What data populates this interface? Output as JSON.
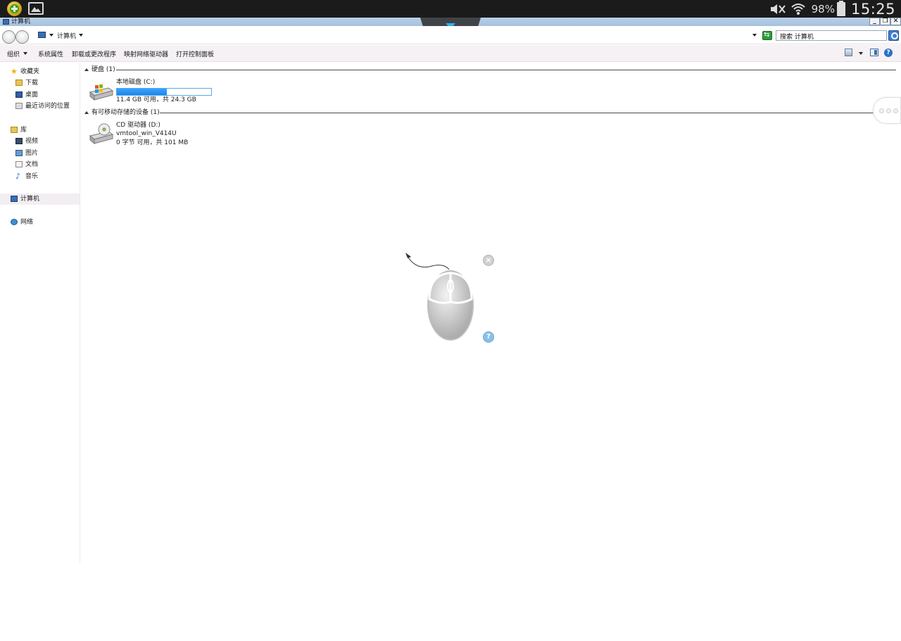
{
  "status_bar": {
    "battery_percent": "98%",
    "time": "15:25"
  },
  "window": {
    "title": "计算机",
    "controls": {
      "minimize": "_",
      "restore": "❐",
      "close": "✕"
    }
  },
  "address_bar": {
    "location": "计算机",
    "search_placeholder": "搜索 计算机"
  },
  "command_bar": {
    "organize": "组织",
    "system_properties": "系统属性",
    "uninstall": "卸载或更改程序",
    "map_drive": "映射网络驱动器",
    "control_panel": "打开控制面板",
    "help": "?"
  },
  "nav_pane": {
    "favorites": "收藏夹",
    "downloads": "下载",
    "desktop": "桌面",
    "recent": "最近访问的位置",
    "libraries": "库",
    "videos": "视频",
    "pictures": "图片",
    "documents": "文档",
    "music": "音乐",
    "computer": "计算机",
    "network": "网络"
  },
  "content": {
    "hdd_group": "硬盘 (1)",
    "removable_group": "有可移动存储的设备 (1)",
    "drives": [
      {
        "name": "本地磁盘 (C:)",
        "sub": "11.4 GB 可用，共 24.3 GB",
        "used_fraction": 0.53
      },
      {
        "name": "CD 驱动器 (D:)",
        "sub1": "vmtool_win_V414U",
        "sub2": "0 字节 可用，共 101 MB"
      }
    ]
  },
  "overlay": {
    "close_glyph": "×",
    "help_glyph": "?"
  },
  "colors": {
    "status_bar": "#1b1b1b",
    "title_bar": "#b9d0e7",
    "command_bar": "#f5f1f4",
    "capacity_fill": "#1b86ea",
    "notch_arrow": "#29b4e6"
  }
}
